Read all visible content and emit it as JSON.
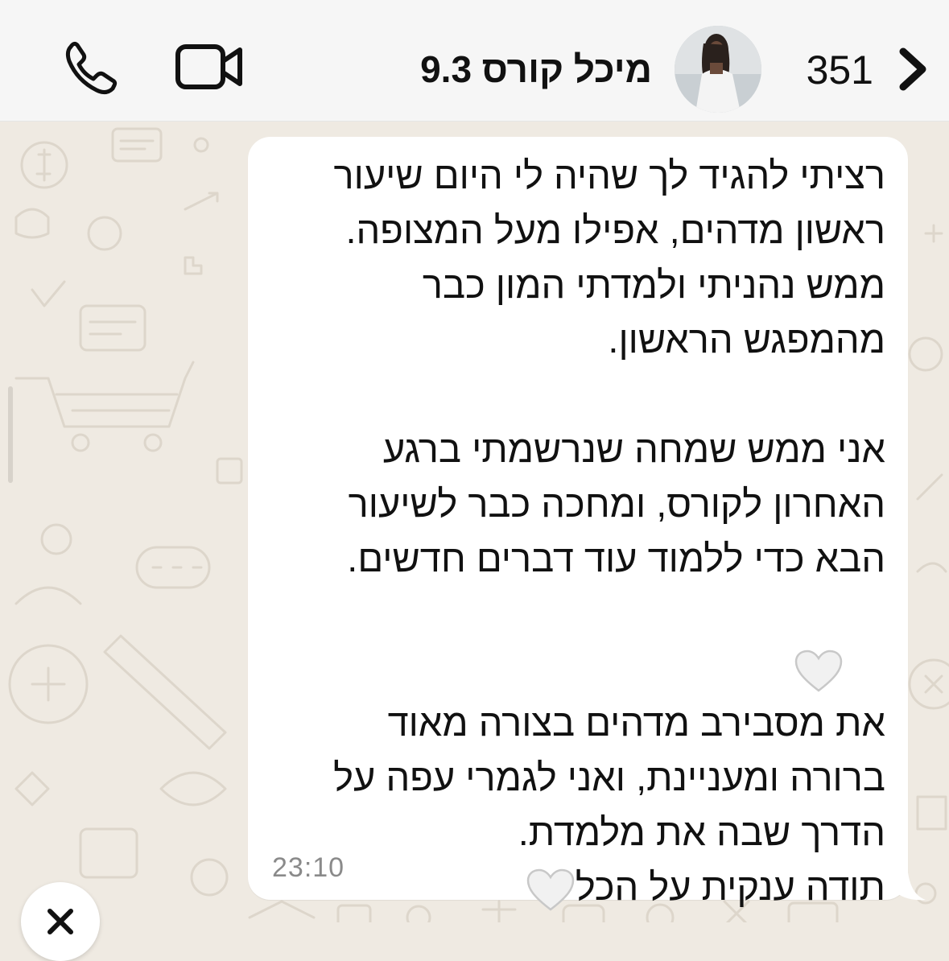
{
  "header": {
    "back_count": "351",
    "contact_name": "מיכל קורס 9.3",
    "icons": {
      "back": "chevron-left-icon",
      "video_call": "video-camera-icon",
      "voice_call": "phone-icon",
      "avatar": "contact-avatar"
    }
  },
  "message": {
    "lines": [
      "רציתי להגיד לך שהיה לי היום שיעור",
      "ראשון מדהים, אפילו מעל המצופה.",
      "ממש נהניתי ולמדתי המון כבר",
      "מהמפגש הראשון.",
      "",
      "אני ממש שמחה שנרשמתי ברגע",
      "האחרון לקורס, ומחכה כבר לשיעור",
      "הבא כדי ללמוד עוד דברים חדשים.",
      "",
      "",
      "את מסבירב מדהים בצורה מאוד",
      "ברורה ומעניינת, ואני לגמרי עפה על",
      "הדרך שבה את מלמדת.",
      "תודה ענקית על הכל"
    ],
    "time": "23:10",
    "emoji": "white-heart-icon"
  },
  "colors": {
    "chat_background": "#efeae2",
    "bubble": "#ffffff",
    "header": "#f6f6f6",
    "text": "#111111",
    "timestamp": "#8a8a8a"
  },
  "overlay": {
    "close_icon": "close-icon"
  }
}
